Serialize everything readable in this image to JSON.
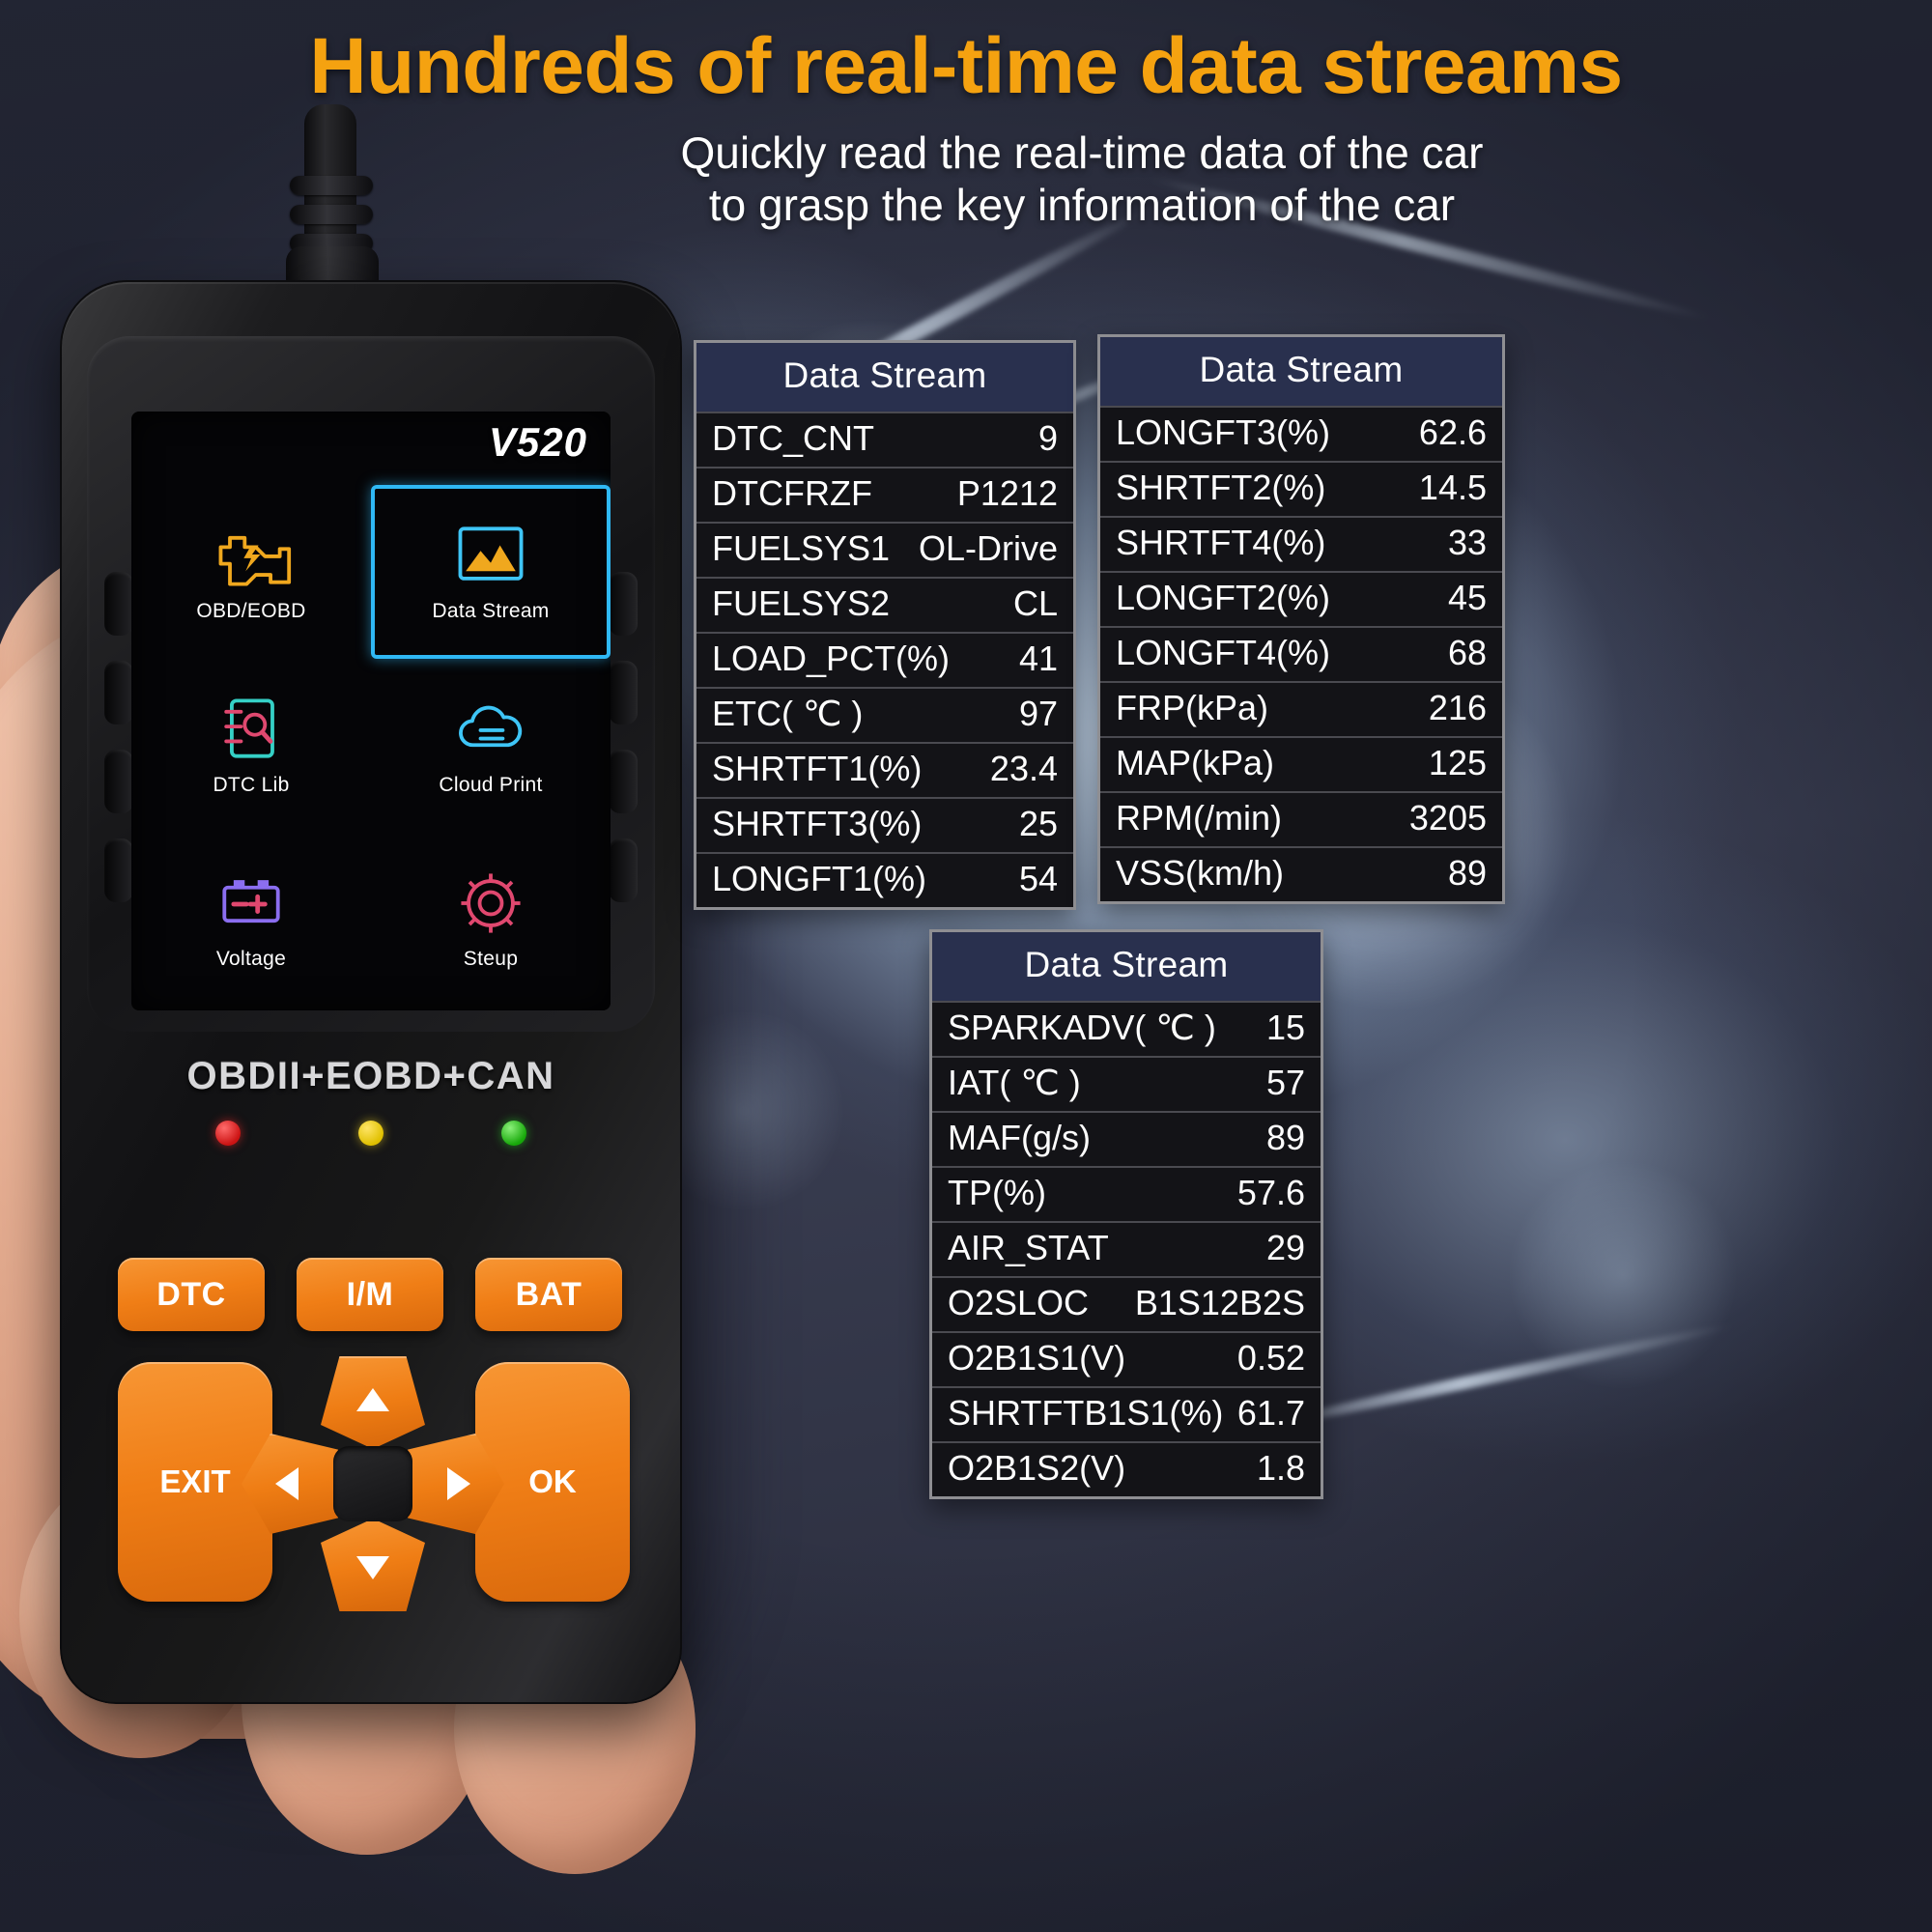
{
  "headline": "Hundreds of real-time data streams",
  "subhead": {
    "line1": "Quickly read the real-time data of the car",
    "line2": "to grasp the key information of the car"
  },
  "device": {
    "model": "V520",
    "brandline": "OBDII+EOBD+CAN",
    "menu": [
      {
        "label": "OBD/EOBD",
        "icon": "engine-check-icon",
        "selected": false
      },
      {
        "label": "Data Stream",
        "icon": "chart-mountain-icon",
        "selected": true
      },
      {
        "label": "DTC Lib",
        "icon": "document-search-icon",
        "selected": false
      },
      {
        "label": "Cloud Print",
        "icon": "cloud-print-icon",
        "selected": false
      },
      {
        "label": "Voltage",
        "icon": "battery-icon",
        "selected": false
      },
      {
        "label": "Steup",
        "icon": "gear-icon",
        "selected": false
      }
    ],
    "leds": [
      {
        "name": "led-red",
        "color": "#cc1313"
      },
      {
        "name": "led-yellow",
        "color": "#e0c000"
      },
      {
        "name": "led-green",
        "color": "#17a80a"
      }
    ],
    "keys": {
      "dtc": "DTC",
      "im": "I/M",
      "bat": "BAT",
      "exit": "EXIT",
      "ok": "OK",
      "up": "▲",
      "down": "▼",
      "left": "◀",
      "right": "▶"
    }
  },
  "tables": [
    {
      "title": "Data Stream",
      "rows": [
        {
          "key": "DTC_CNT",
          "value": "9"
        },
        {
          "key": "DTCFRZF",
          "value": "P1212"
        },
        {
          "key": "FUELSYS1",
          "value": "OL-Drive"
        },
        {
          "key": "FUELSYS2",
          "value": "CL"
        },
        {
          "key": "LOAD_PCT(%)",
          "value": "41"
        },
        {
          "key": "ETC( ℃ )",
          "value": "97"
        },
        {
          "key": "SHRTFT1(%)",
          "value": "23.4"
        },
        {
          "key": "SHRTFT3(%)",
          "value": "25"
        },
        {
          "key": "LONGFT1(%)",
          "value": "54"
        }
      ]
    },
    {
      "title": "Data Stream",
      "rows": [
        {
          "key": "LONGFT3(%)",
          "value": "62.6"
        },
        {
          "key": "SHRTFT2(%)",
          "value": "14.5"
        },
        {
          "key": "SHRTFT4(%)",
          "value": "33"
        },
        {
          "key": "LONGFT2(%)",
          "value": "45"
        },
        {
          "key": "LONGFT4(%)",
          "value": "68"
        },
        {
          "key": "FRP(kPa)",
          "value": "216"
        },
        {
          "key": "MAP(kPa)",
          "value": "125"
        },
        {
          "key": "RPM(/min)",
          "value": "3205"
        },
        {
          "key": "VSS(km/h)",
          "value": "89"
        }
      ]
    },
    {
      "title": "Data Stream",
      "rows": [
        {
          "key": "SPARKADV( ℃ )",
          "value": "15"
        },
        {
          "key": "IAT( ℃ )",
          "value": "57"
        },
        {
          "key": "MAF(g/s)",
          "value": "89"
        },
        {
          "key": "TP(%)",
          "value": "57.6"
        },
        {
          "key": "AIR_STAT",
          "value": "29"
        },
        {
          "key": "O2SLOC",
          "value": "B1S12B2S"
        },
        {
          "key": "O2B1S1(V)",
          "value": "0.52"
        },
        {
          "key": "SHRTFTB1S1(%)",
          "value": "61.7"
        },
        {
          "key": "O2B1S2(V)",
          "value": "1.8"
        }
      ]
    }
  ],
  "colors": {
    "headline": "#f5a210",
    "accent_orange": "#f07e16",
    "selection_blue": "#2fb8f4",
    "table_header": "#29304e",
    "table_body": "#131317",
    "table_border": "#8e8e92"
  }
}
